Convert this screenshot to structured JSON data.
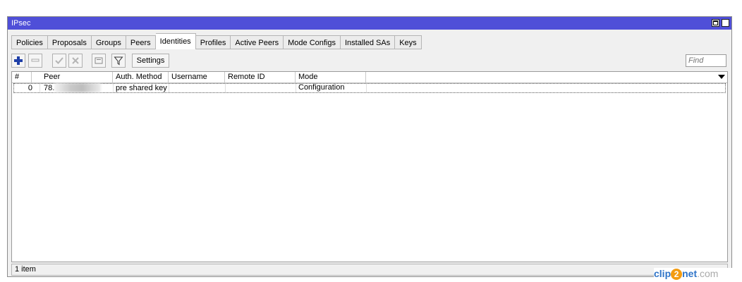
{
  "window": {
    "title": "IPsec"
  },
  "tabs": [
    {
      "label": "Policies"
    },
    {
      "label": "Proposals"
    },
    {
      "label": "Groups"
    },
    {
      "label": "Peers"
    },
    {
      "label": "Identities"
    },
    {
      "label": "Profiles"
    },
    {
      "label": "Active Peers"
    },
    {
      "label": "Mode Configs"
    },
    {
      "label": "Installed SAs"
    },
    {
      "label": "Keys"
    }
  ],
  "active_tab": "Identities",
  "toolbar": {
    "settings_label": "Settings",
    "find_placeholder": "Find"
  },
  "table": {
    "columns": [
      "#",
      "Peer",
      "Auth. Method",
      "Username",
      "Remote ID",
      "Mode Configuration"
    ],
    "rows": [
      {
        "num": "0",
        "peer": "78.",
        "auth_method": "pre shared key",
        "username": "",
        "remote_id": "",
        "mode_configuration": ""
      }
    ]
  },
  "status": {
    "count": "1 item"
  },
  "watermark": {
    "part1": "clip",
    "part2": "2",
    "part3": "net",
    "part4": ".com"
  },
  "colors": {
    "titlebar": "#4f4fd8",
    "add_icon": "#1f3fa8",
    "watermark_blue": "#2f74c8",
    "watermark_orange": "#f39c12"
  }
}
